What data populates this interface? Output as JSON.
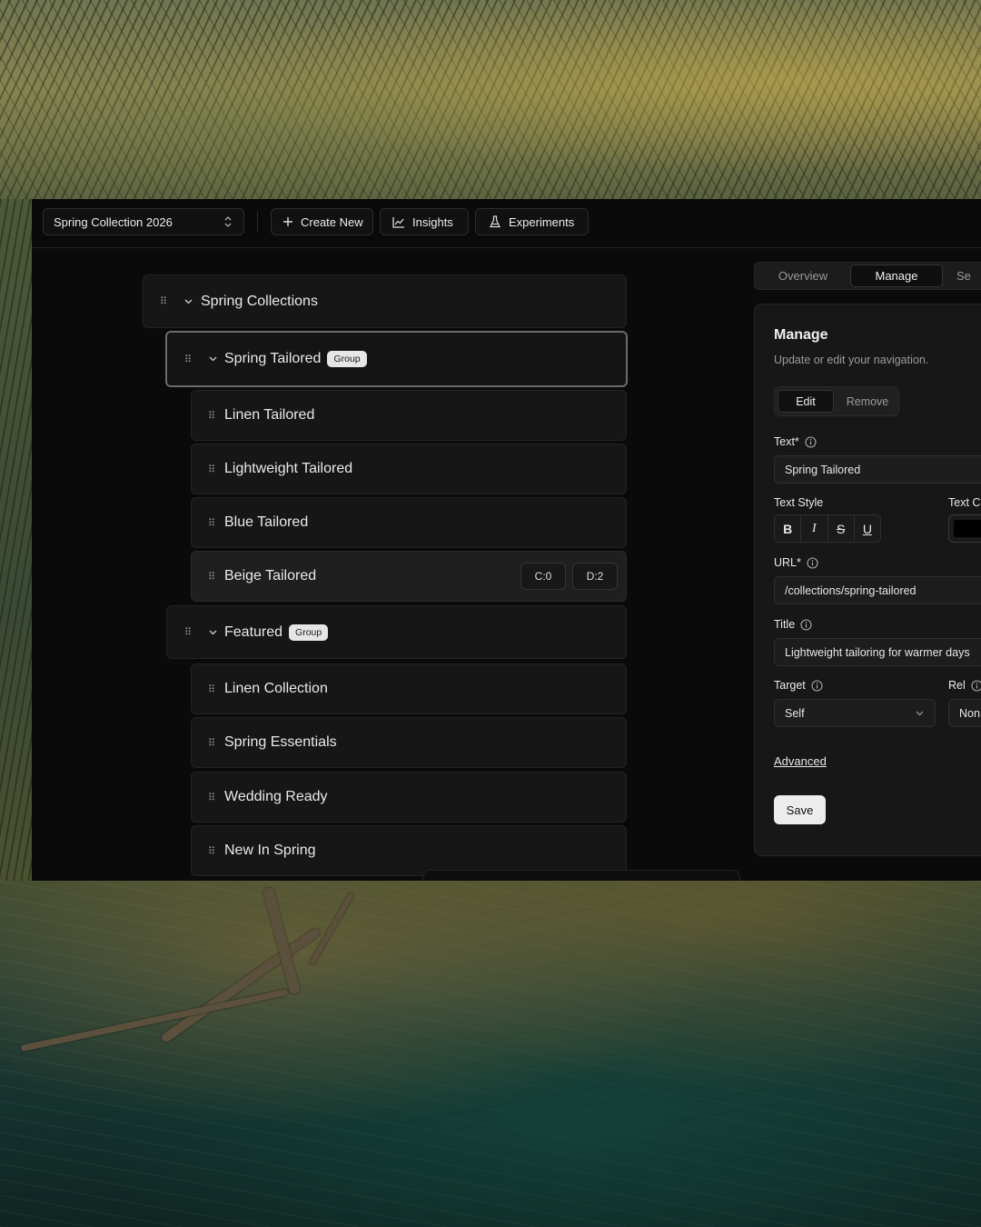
{
  "toolbar": {
    "collection_select": "Spring Collection 2026",
    "create_new": "Create New",
    "insights": "Insights",
    "experiments": "Experiments"
  },
  "tree": {
    "root": {
      "label": "Spring Collections"
    },
    "groups": [
      {
        "label": "Spring Tailored",
        "badge": "Group",
        "items": [
          "Linen Tailored",
          "Lightweight Tailored",
          "Blue Tailored",
          "Beige Tailored"
        ],
        "hover_item_pills": [
          "C:0",
          "D:2"
        ]
      },
      {
        "label": "Featured",
        "badge": "Group",
        "items": [
          "Linen Collection",
          "Spring Essentials",
          "Wedding Ready",
          "New In Spring"
        ]
      }
    ]
  },
  "tabs": [
    "Overview",
    "Manage",
    "Se"
  ],
  "panel": {
    "title": "Manage",
    "subtitle": "Update or edit your navigation.",
    "mode_edit": "Edit",
    "mode_remove": "Remove",
    "text_label": "Text*",
    "text_value": "Spring Tailored",
    "text_style_label": "Text Style",
    "text_color_label": "Text C",
    "text_color": "#000000",
    "style_buttons": [
      "B",
      "I",
      "S",
      "U"
    ],
    "url_label": "URL*",
    "url_value": "/collections/spring-tailored",
    "title_label": "Title",
    "title_value": "Lightweight tailoring for warmer days",
    "target_label": "Target",
    "target_value": "Self",
    "rel_label": "Rel",
    "rel_value": "Non",
    "advanced": "Advanced",
    "save": "Save"
  }
}
